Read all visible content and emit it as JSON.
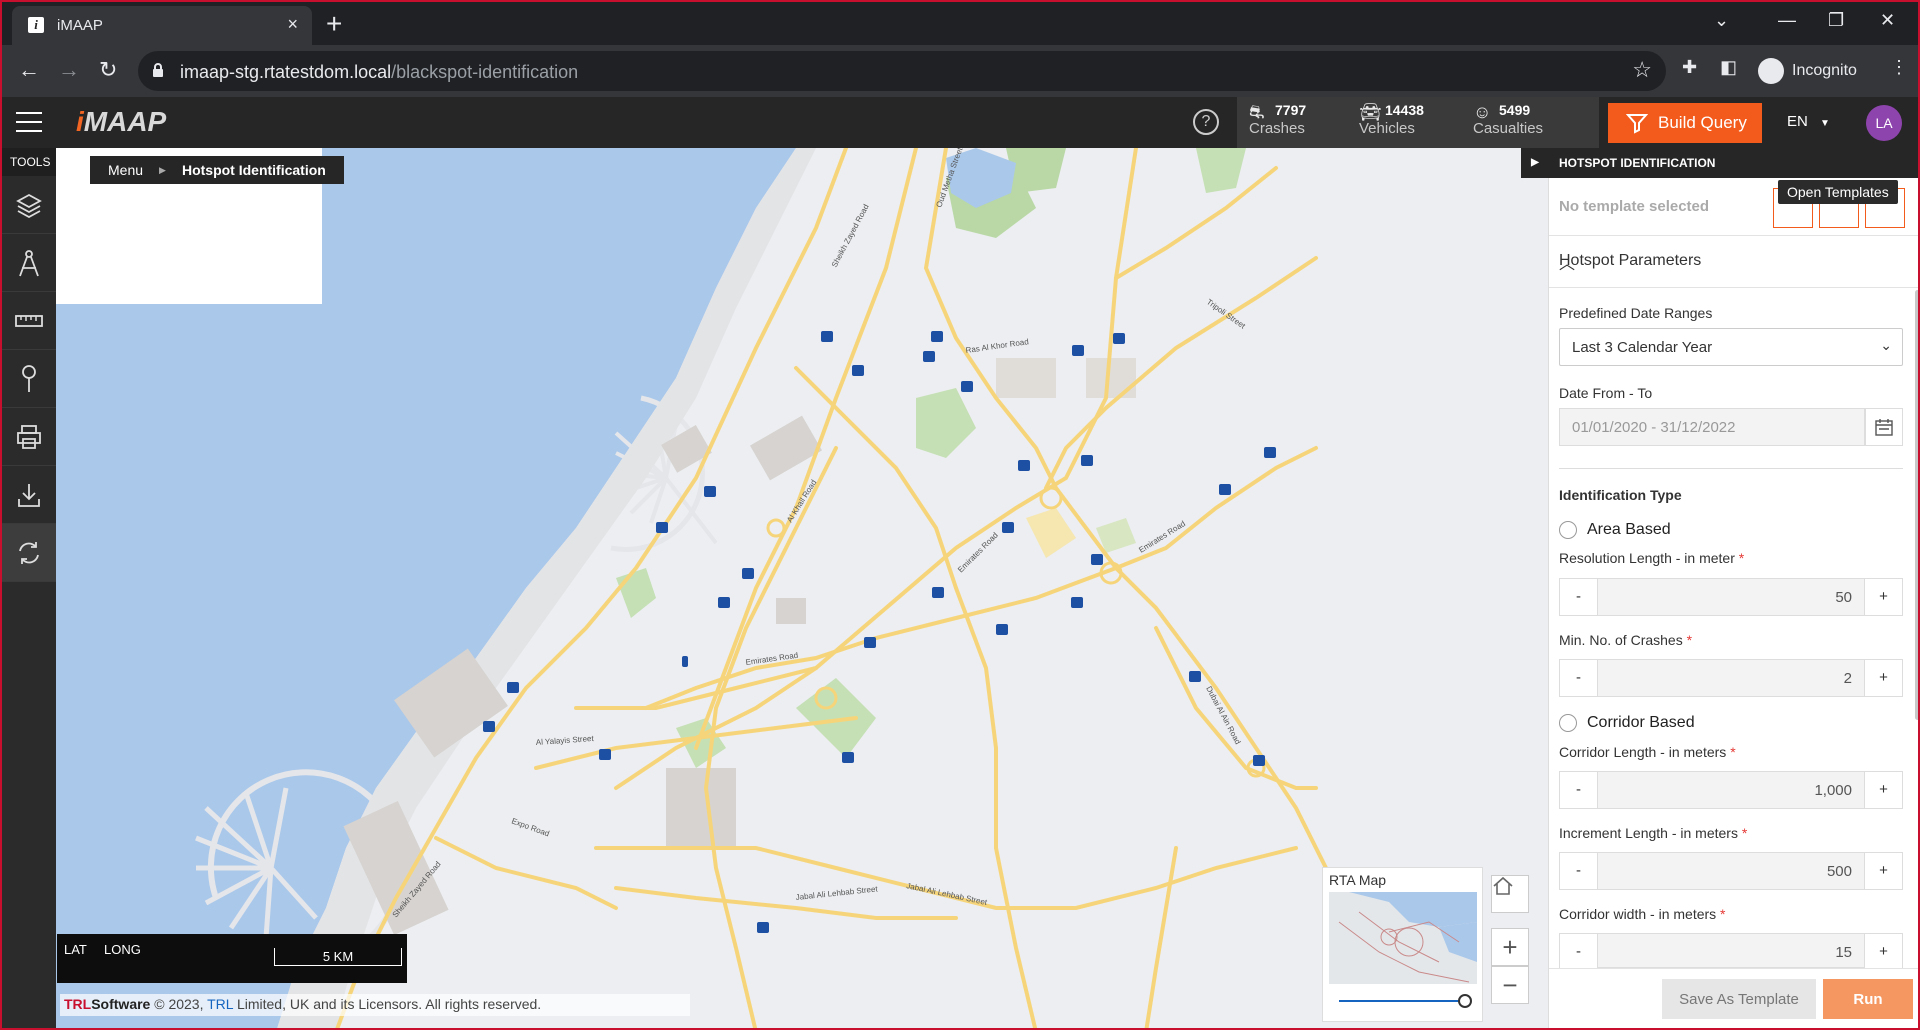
{
  "browser": {
    "tab_title": "iMAAP",
    "url_host": "imaap-stg.rtatestdom.local",
    "url_path": "/blackspot-identification",
    "profile": "Incognito"
  },
  "header": {
    "logo": "iMAAP",
    "stats": [
      {
        "icon": "crash-icon",
        "value": "7797",
        "label": "Crashes"
      },
      {
        "icon": "vehicle-icon",
        "value": "14438",
        "label": "Vehicles"
      },
      {
        "icon": "person-icon",
        "value": "5499",
        "label": "Casualties"
      }
    ],
    "build_query": "Build Query",
    "language": "EN",
    "avatar_initials": "LA"
  },
  "tools": {
    "title": "TOOLS",
    "items": [
      "layers-icon",
      "compass-icon",
      "ruler-icon",
      "pin-icon",
      "print-icon",
      "download-icon",
      "refresh-icon"
    ]
  },
  "breadcrumb": {
    "menu": "Menu",
    "current": "Hotspot Identification"
  },
  "map": {
    "lat_label": "LAT",
    "long_label": "LONG",
    "scale_label": "5 KM",
    "copyright_brand_a": "TRL",
    "copyright_brand_b": "Software",
    "copyright_text_a": "© 2023, ",
    "copyright_link": "TRL",
    "copyright_text_b": " Limited, UK and its Licensors. All rights reserved.",
    "minimap_title": "RTA Map",
    "road_labels": [
      "Sheikh Zayed Road",
      "Al Khail Road",
      "Emirates Road",
      "Al Yalayis Street",
      "Expo Road",
      "Jabal Ali Lehbab Street",
      "Dubai Al Ain Road",
      "Ras Al Khor Road",
      "Tripoli Street",
      "Oud Metha Street"
    ]
  },
  "panel": {
    "title": "HOTSPOT IDENTIFICATION",
    "no_template": "No template selected",
    "tooltip": "Open Templates",
    "section_title": "Hotspot Parameters",
    "date_ranges_label": "Predefined Date Ranges",
    "date_range_value": "Last 3 Calendar Year",
    "date_from_to_label": "Date From - To",
    "date_from_to_value": "01/01/2020 - 31/12/2022",
    "identification_type_label": "Identification Type",
    "area_based": "Area Based",
    "resolution_label": "Resolution Length - in meter",
    "resolution_value": "50",
    "min_crashes_label": "Min. No. of Crashes",
    "min_crashes_value": "2",
    "corridor_based": "Corridor Based",
    "corridor_length_label": "Corridor Length - in meters",
    "corridor_length_value": "1,000",
    "increment_label": "Increment Length - in meters",
    "increment_value": "500",
    "corridor_width_label": "Corridor width - in meters",
    "corridor_width_value": "15",
    "required_mark": "*",
    "minus": "-",
    "plus": "+",
    "save_template": "Save As Template",
    "run": "Run"
  }
}
